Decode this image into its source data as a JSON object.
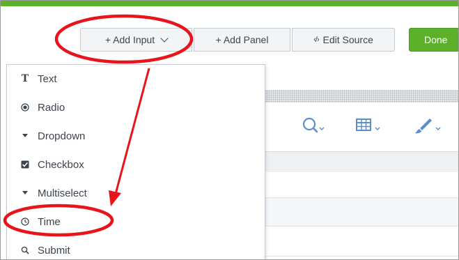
{
  "toolbar": {
    "add_input": "+ Add Input",
    "add_panel": "+ Add Panel",
    "edit_source": "Edit Source",
    "edit_source_glyph": "‹/›",
    "done": "Done"
  },
  "menu": {
    "items": [
      {
        "label": "Text",
        "icon": "text-T-icon"
      },
      {
        "label": "Radio",
        "icon": "radio-icon"
      },
      {
        "label": "Dropdown",
        "icon": "triangle-down-icon"
      },
      {
        "label": "Checkbox",
        "icon": "checkbox-icon"
      },
      {
        "label": "Multiselect",
        "icon": "triangle-down-icon"
      },
      {
        "label": "Time",
        "icon": "clock-icon"
      },
      {
        "label": "Submit",
        "icon": "search-icon"
      }
    ]
  },
  "colors": {
    "accent_green": "#5cb02a",
    "annotation_red": "#e8141b",
    "icon_blue": "#5a8fcc"
  },
  "panel_icons": [
    "search-icon",
    "table-icon",
    "paintbrush-icon"
  ]
}
